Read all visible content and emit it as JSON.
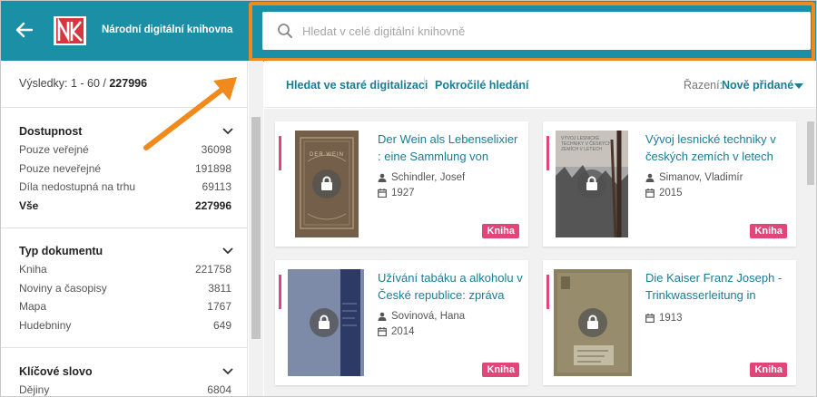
{
  "header": {
    "brand": "Národní digitální knihovna",
    "logo_text": "NK",
    "search_placeholder": "Hledat v celé digitální knihovně",
    "search_value": ""
  },
  "sidebar": {
    "results_prefix": "Výsledky: 1 - 60 / ",
    "results_total": "227996",
    "facets": [
      {
        "title": "Dostupnost",
        "items": [
          {
            "label": "Pouze veřejné",
            "count": "36098"
          },
          {
            "label": "Pouze neveřejné",
            "count": "191898"
          },
          {
            "label": "Díla nedostupná na trhu",
            "count": "69113"
          },
          {
            "label": "Vše",
            "count": "227996"
          }
        ]
      },
      {
        "title": "Typ dokumentu",
        "items": [
          {
            "label": "Kniha",
            "count": "221758"
          },
          {
            "label": "Noviny a časopisy",
            "count": "3811"
          },
          {
            "label": "Mapa",
            "count": "1767"
          },
          {
            "label": "Hudebniny",
            "count": "649"
          }
        ]
      },
      {
        "title": "Klíčové slovo",
        "items": [
          {
            "label": "Dějiny",
            "count": "6804"
          }
        ]
      }
    ]
  },
  "toolbar": {
    "old_search": "Hledat ve staré digitalizaci",
    "advanced_search": "Pokročilé hledání",
    "sort_label": "Řazení:",
    "sort_value": "Nově přidané"
  },
  "results": [
    {
      "title": "Der Wein als Lebenselixier : eine Sammlung von",
      "author": "Schindler, Josef",
      "year": "1927",
      "type": "Kniha",
      "cover_text": "DER WEIN"
    },
    {
      "title": "Vývoj lesnické techniky v českých zemích v letech",
      "author": "Simanov, Vladimír",
      "year": "2015",
      "type": "Kniha",
      "cover_text": "VÝVOJ LESNICKÉ TECHNIKY V ČESKÝCH ZEMÍCH V LETECH"
    },
    {
      "title": "Užívání tabáku a alkoholu v České republice: zpráva",
      "author": "Sovinová, Hana",
      "year": "2014",
      "type": "Kniha",
      "cover_text": ""
    },
    {
      "title": "Die Kaiser Franz Joseph - Trinkwasserleitung in",
      "author": "",
      "year": "1913",
      "type": "Kniha",
      "cover_text": ""
    }
  ],
  "colors": {
    "header_bg": "#1a8fa6",
    "accent": "#e2457a",
    "link": "#1a7d94",
    "highlight": "#f08a1c"
  }
}
